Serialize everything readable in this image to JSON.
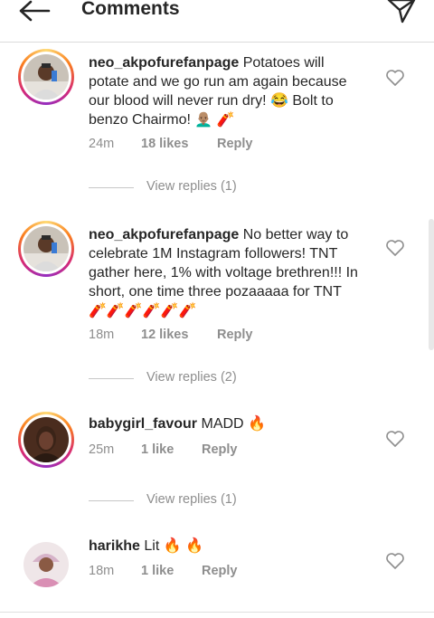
{
  "header": {
    "title": "Comments"
  },
  "comments": [
    {
      "username": "neo_akpofurefanpage",
      "text": "Potatoes will potate and we go run am again because our blood will never run dry! 😂 Bolt to benzo Chairmo! 👨🏽‍🦲 🧨",
      "time": "24m",
      "likes": "18 likes",
      "reply": "Reply",
      "view_replies": "View replies (1)"
    },
    {
      "username": "neo_akpofurefanpage",
      "text": "No better way to celebrate 1M Instagram followers! TNT gather here, 1% with voltage brethren!!! In short, one time three pozaaaaa for TNT 🧨🧨🧨🧨🧨🧨",
      "time": "18m",
      "likes": "12 likes",
      "reply": "Reply",
      "view_replies": "View replies (2)"
    },
    {
      "username": "babygirl_favour",
      "text": "MADD 🔥",
      "time": "25m",
      "likes": "1 like",
      "reply": "Reply",
      "view_replies": "View replies (1)"
    },
    {
      "username": "harikhe",
      "text": "Lit 🔥 🔥",
      "time": "18m",
      "likes": "1 like",
      "reply": "Reply"
    }
  ],
  "icons": {
    "back": "arrow-left-icon",
    "send": "paper-plane-icon",
    "like": "heart-outline-icon"
  },
  "colors": {
    "text": "#262626",
    "secondary": "#8e8e8e",
    "story_ring": "#d62976"
  }
}
